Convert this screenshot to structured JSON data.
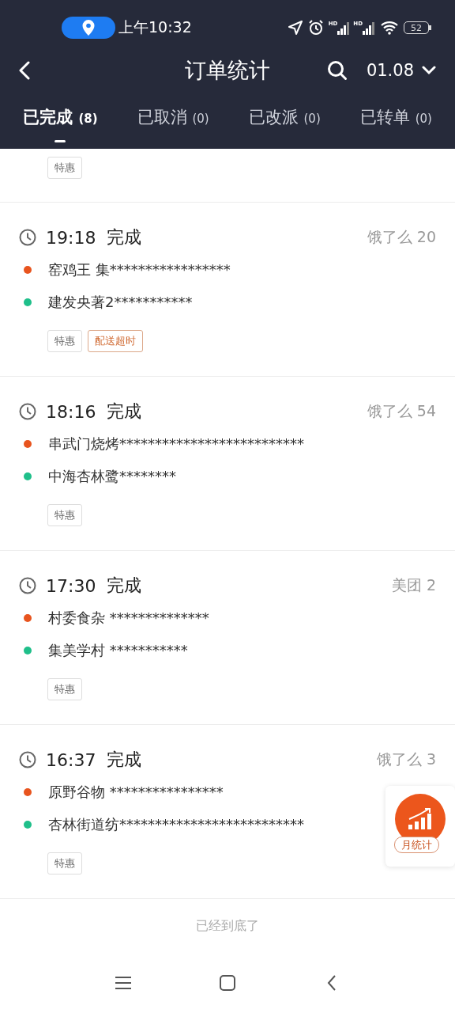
{
  "status_bar": {
    "time": "上午10:32",
    "signal_labels": [
      "HD",
      "HD"
    ],
    "battery": "52"
  },
  "header": {
    "title": "订单统计",
    "date": "01.08"
  },
  "tabs": [
    {
      "label": "已完成",
      "count": "(8)",
      "selected": true
    },
    {
      "label": "已取消",
      "count": "(0)",
      "selected": false
    },
    {
      "label": "已改派",
      "count": "(0)",
      "selected": false
    },
    {
      "label": "已转单",
      "count": "(0)",
      "selected": false
    }
  ],
  "partial_order": {
    "tags": [
      {
        "text": "特惠",
        "kind": "normal"
      }
    ]
  },
  "orders": [
    {
      "time": "19:18",
      "status": "完成",
      "platform": "饿了么 20",
      "stops": [
        {
          "text": "窑鸡王 集*****************",
          "color": "#e8541e"
        },
        {
          "text": "建发央著2***********",
          "color": "#1fbf8a"
        }
      ],
      "tags": [
        {
          "text": "特惠",
          "kind": "normal"
        },
        {
          "text": "配送超时",
          "kind": "warning"
        }
      ]
    },
    {
      "time": "18:16",
      "status": "完成",
      "platform": "饿了么 54",
      "stops": [
        {
          "text": "串武门烧烤**************************",
          "color": "#e8541e"
        },
        {
          "text": "中海杏林鹭********",
          "color": "#1fbf8a"
        }
      ],
      "tags": [
        {
          "text": "特惠",
          "kind": "normal"
        }
      ]
    },
    {
      "time": "17:30",
      "status": "完成",
      "platform": "美团 2",
      "stops": [
        {
          "text": "村委食杂 **************",
          "color": "#e8541e"
        },
        {
          "text": "集美学村 ***********",
          "color": "#1fbf8a"
        }
      ],
      "tags": [
        {
          "text": "特惠",
          "kind": "normal"
        }
      ]
    },
    {
      "time": "16:37",
      "status": "完成",
      "platform": "饿了么 3",
      "stops": [
        {
          "text": "原野谷物 ****************",
          "color": "#e8541e"
        },
        {
          "text": "杏林街道纺**************************",
          "color": "#1fbf8a"
        }
      ],
      "tags": [
        {
          "text": "特惠",
          "kind": "normal"
        }
      ]
    }
  ],
  "end_note": "已经到底了",
  "float_button": {
    "label": "月统计"
  }
}
